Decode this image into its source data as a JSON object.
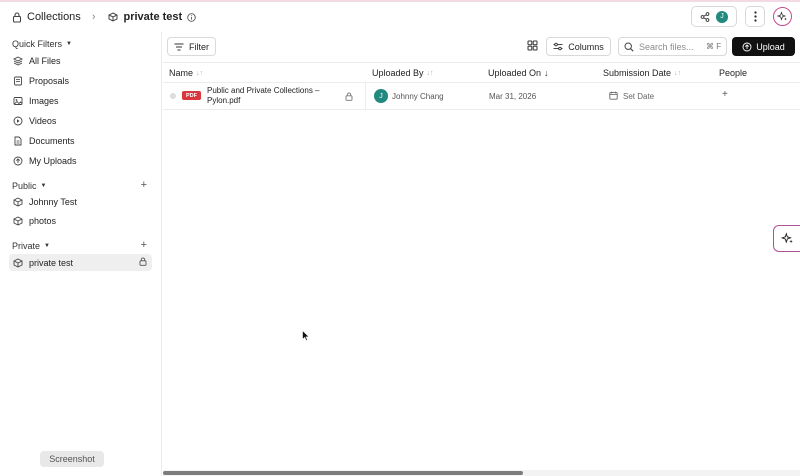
{
  "breadcrumb": {
    "root": "Collections",
    "current": "private test"
  },
  "header": {
    "share_avatar_initial": "J"
  },
  "sidebar": {
    "quick_filters_title": "Quick Filters",
    "quick_filters": [
      {
        "label": "All Files",
        "icon": "layers-icon"
      },
      {
        "label": "Proposals",
        "icon": "book-icon"
      },
      {
        "label": "Images",
        "icon": "image-icon"
      },
      {
        "label": "Videos",
        "icon": "play-icon"
      },
      {
        "label": "Documents",
        "icon": "document-icon"
      },
      {
        "label": "My Uploads",
        "icon": "upload-circle-icon"
      }
    ],
    "public_title": "Public",
    "public_items": [
      {
        "label": "Johnny Test"
      },
      {
        "label": "photos"
      }
    ],
    "private_title": "Private",
    "private_items": [
      {
        "label": "private test"
      }
    ]
  },
  "toolbar": {
    "filter_label": "Filter",
    "columns_label": "Columns",
    "search_placeholder": "Search files...",
    "search_shortcut": "⌘ F",
    "upload_label": "Upload"
  },
  "table": {
    "columns": [
      "Name",
      "Uploaded By",
      "Uploaded On",
      "Submission Date",
      "People"
    ],
    "rows": [
      {
        "file_type": "PDF",
        "name": "Public and Private Collections – Pylon.pdf",
        "uploader_initial": "J",
        "uploader": "Johnny Chang",
        "uploaded_on": "Mar 31, 2026",
        "submission_date": "Set Date",
        "people": "+"
      }
    ]
  },
  "footer": {
    "screenshot_label": "Screenshot"
  },
  "colors": {
    "accent_ai": "#c54b8c",
    "avatar": "#21897e",
    "pdf_badge": "#d9363e",
    "upload_button": "#111111"
  }
}
